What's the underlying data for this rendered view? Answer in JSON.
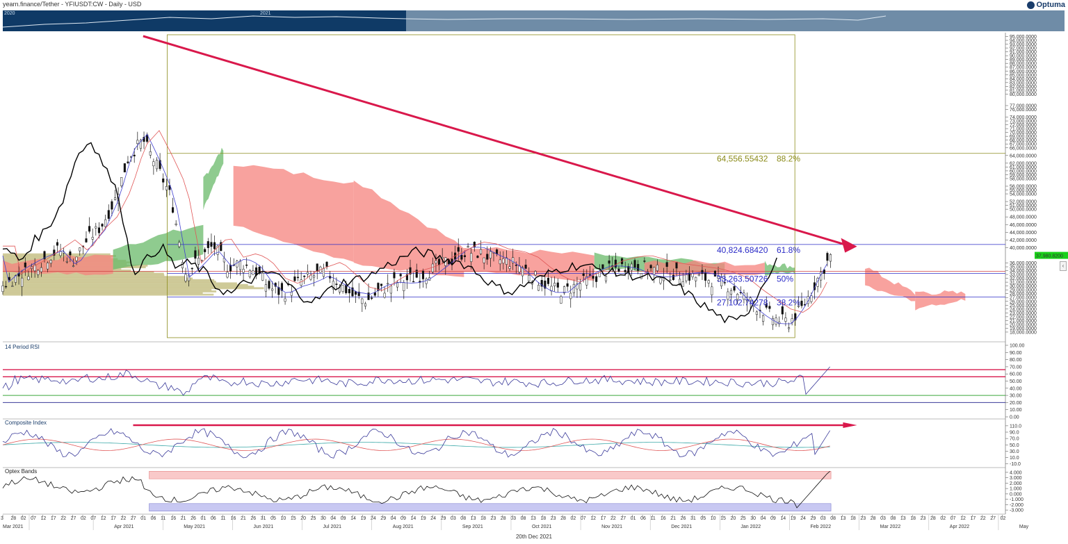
{
  "header": {
    "title": "yearn.finance/Tether - YFIUSDT:CW - Daily - USD",
    "brand": "Optuma"
  },
  "navigator": {
    "years": [
      "2020",
      "2021"
    ]
  },
  "footer": {
    "date_label": "20th Dec 2021"
  },
  "colors": {
    "trendline": "#d9184b",
    "fib_top": "#8b8b1a",
    "fib_mid": "#2b2bc7",
    "cloud_bull": "#6ab96a",
    "cloud_bear": "#f5837d",
    "volume_profile": "#c8c28a",
    "rsi_line": "#3a3a9a",
    "last_price_bg": "#19d019"
  },
  "chart_data": [
    {
      "type": "candlestick",
      "name": "price",
      "ylim": [
        16000,
        96000
      ],
      "yticks": [
        "95,000.0000",
        "94,000.0000",
        "93,000.0000",
        "92,000.0000",
        "91,000.0000",
        "90,000.0000",
        "89,000.0000",
        "88,000.0000",
        "87,000.0000",
        "86,000.0000",
        "85,000.0000",
        "84,000.0000",
        "83,000.0000",
        "82,000.0000",
        "81,000.0000",
        "80,000.0000",
        "77,000.0000",
        "76,000.0000",
        "74,000.0000",
        "73,000.0000",
        "72,000.0000",
        "71,000.0000",
        "70,000.0000",
        "69,000.0000",
        "68,000.0000",
        "67,000.0000",
        "66,000.0000",
        "64,000.0000",
        "62,000.0000",
        "61,000.0000",
        "60,000.0000",
        "59,000.0000",
        "58,000.0000",
        "56,000.0000",
        "55,000.0000",
        "54,000.0000",
        "52,000.0000",
        "51,000.0000",
        "50,000.0000",
        "48,000.0000",
        "46,000.0000",
        "44,000.0000",
        "42,000.0000",
        "40,000.0000",
        "36,000.0000",
        "35,000.0000",
        "34,000.0000",
        "33,000.0000",
        "32,000.0000",
        "31,000.0000",
        "30,000.0000",
        "29,000.0000",
        "28,000.0000",
        "27,000.0000",
        "26,000.0000",
        "25,000.0000",
        "24,000.0000",
        "23,000.0000",
        "22,000.0000",
        "21,000.0000",
        "20,000.0000",
        "19,000.0000",
        "18,000.0000"
      ],
      "last_price": "37,980.8200",
      "fib_levels": [
        {
          "price": 64556.55432,
          "label": "64,556.55432",
          "pct": "88.2%"
        },
        {
          "price": 40824.6842,
          "label": "40,824.68420",
          "pct": "61.8%"
        },
        {
          "price": 33263.50726,
          "label": "33,263.50726",
          "pct": "50%"
        },
        {
          "price": 27102.74278,
          "label": "27,102.74278",
          "pct": "38.2%"
        }
      ],
      "horizontal_line": 33800,
      "close_series": [
        [
          0,
          30200
        ],
        [
          7,
          32500
        ],
        [
          14,
          34500
        ],
        [
          21,
          37000
        ],
        [
          28,
          39500
        ],
        [
          35,
          36500
        ],
        [
          42,
          42000
        ],
        [
          49,
          45500
        ],
        [
          56,
          52500
        ],
        [
          63,
          64000
        ],
        [
          70,
          68000
        ],
        [
          77,
          61000
        ],
        [
          84,
          53000
        ],
        [
          91,
          33500
        ],
        [
          98,
          37000
        ],
        [
          105,
          40500
        ],
        [
          112,
          35000
        ],
        [
          119,
          36000
        ],
        [
          126,
          34000
        ],
        [
          133,
          29500
        ],
        [
          140,
          28000
        ],
        [
          147,
          31000
        ],
        [
          154,
          32500
        ],
        [
          161,
          33800
        ],
        [
          168,
          30500
        ],
        [
          175,
          27200
        ],
        [
          182,
          26200
        ],
        [
          189,
          29000
        ],
        [
          196,
          31000
        ],
        [
          203,
          31800
        ],
        [
          210,
          33000
        ],
        [
          217,
          35200
        ],
        [
          224,
          37000
        ],
        [
          231,
          39000
        ],
        [
          238,
          38500
        ],
        [
          245,
          37000
        ],
        [
          252,
          36500
        ],
        [
          259,
          35000
        ],
        [
          266,
          32000
        ],
        [
          273,
          29500
        ],
        [
          280,
          28500
        ],
        [
          287,
          30500
        ],
        [
          294,
          32000
        ],
        [
          301,
          34000
        ],
        [
          308,
          35000
        ],
        [
          315,
          35500
        ],
        [
          322,
          34500
        ],
        [
          329,
          33500
        ],
        [
          336,
          33000
        ],
        [
          343,
          32500
        ],
        [
          350,
          32000
        ],
        [
          357,
          31000
        ],
        [
          364,
          29500
        ],
        [
          371,
          26500
        ],
        [
          378,
          24000
        ],
        [
          385,
          21500
        ],
        [
          392,
          20500
        ],
        [
          399,
          24500
        ],
        [
          406,
          31500
        ],
        [
          413,
          37900
        ]
      ],
      "x_day_span": 500,
      "x_month_labels": [
        "Mar 2021",
        "Apr 2021",
        "May 2021",
        "Jun 2021",
        "Jul 2021",
        "Aug 2021",
        "Sep 2021",
        "Oct 2021",
        "Nov 2021",
        "Dec 2021",
        "Jan 2022",
        "Feb 2022",
        "Mar 2022",
        "Apr 2022",
        "May"
      ],
      "x_day_ticks": [
        "3",
        "28",
        "02",
        "07",
        "12",
        "17",
        "22",
        "27",
        "02",
        "07",
        "12",
        "17",
        "22",
        "27",
        "01",
        "06",
        "11",
        "16",
        "21",
        "26",
        "01",
        "06",
        "11",
        "16",
        "21",
        "26",
        "31",
        "05",
        "10",
        "15",
        "20",
        "25",
        "30",
        "04",
        "09",
        "14",
        "19",
        "24",
        "29",
        "04",
        "09",
        "14",
        "19",
        "24",
        "29",
        "03",
        "08",
        "13",
        "18",
        "23",
        "28",
        "03",
        "08",
        "13",
        "18",
        "23",
        "28",
        "02",
        "07",
        "12",
        "17",
        "22",
        "27",
        "01",
        "06",
        "11",
        "16",
        "21",
        "26",
        "31",
        "05",
        "10",
        "15",
        "20",
        "25",
        "30",
        "04",
        "09",
        "14",
        "19",
        "24",
        "29",
        "03",
        "08",
        "13",
        "18",
        "23",
        "28",
        "03",
        "08",
        "13",
        "18",
        "23",
        "28",
        "02",
        "07",
        "12",
        "17",
        "22",
        "27",
        "02"
      ]
    },
    {
      "type": "line",
      "name": "rsi",
      "title": "14 Period RSI",
      "ylim": [
        0,
        100
      ],
      "yticks": [
        "100.00",
        "90.00",
        "80.00",
        "70.00",
        "60.00",
        "50.00",
        "40.00",
        "30.00",
        "20.00",
        "10.00",
        "0.00"
      ],
      "levels": [
        66,
        56,
        30,
        20
      ]
    },
    {
      "type": "line",
      "name": "composite",
      "title": "Composite Index",
      "ylim": [
        -15,
        125
      ],
      "yticks": [
        "110.0",
        "90.0",
        "70.0",
        "50.0",
        "30.0",
        "10.0",
        "-10.0"
      ]
    },
    {
      "type": "line",
      "name": "optex",
      "title": "Optex Bands",
      "ylim": [
        -3.5,
        4.5
      ],
      "yticks": [
        "4.000",
        "3.000",
        "2.000",
        "1.000",
        "0.000",
        "-1.000",
        "-2.000",
        "-3.000"
      ]
    }
  ]
}
